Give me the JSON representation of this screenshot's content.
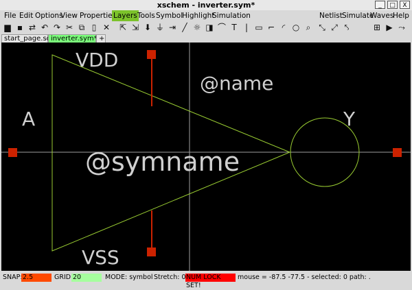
{
  "window": {
    "title": "xschem - inverter.sym*",
    "btn_min": "_",
    "btn_max": "□",
    "btn_close": "X"
  },
  "menu": {
    "left": [
      "File",
      "Edit",
      "Options",
      "View",
      "Properties",
      "Layers",
      "Tools",
      "Symbol",
      "Highlight",
      "Simulation"
    ],
    "right": [
      "Netlist",
      "Simulate",
      "Waves",
      "Help"
    ],
    "active": "Layers"
  },
  "toolbar": {
    "icons": [
      "open-folder-icon",
      "save-icon",
      "reload-icon",
      "undo-icon",
      "redo-icon",
      "cut-icon",
      "copy-icon",
      "delete-icon",
      "move-icon",
      "descend-icon",
      "ascend-icon",
      "duplicate-icon",
      "wire-icon",
      "pin-icon",
      "label-icon",
      "probe-icon",
      "line-icon",
      "rect-icon",
      "polygon-icon",
      "arc-icon",
      "circle-icon",
      "zoom-icon",
      "zoom-fit-icon",
      "zoom-in-icon",
      "zoom-out-icon",
      "netlist-icon",
      "simulate-icon",
      "waves-icon"
    ]
  },
  "tabs": [
    {
      "label": "start_page.sch",
      "active": false
    },
    {
      "label": "inverter.sym*",
      "active": true
    },
    {
      "label": "+",
      "active": false
    }
  ],
  "canvas": {
    "labels": {
      "vdd": "VDD",
      "name": "@name",
      "a": "A",
      "y": "Y",
      "symname": "@symname",
      "vss": "VSS"
    },
    "colors": {
      "background": "#000000",
      "symbol": "#9acd32",
      "pin": "#cc2200",
      "text": "#d0d0d0",
      "axis": "#a0a0a0"
    }
  },
  "status": {
    "snap_label": "SNAP:",
    "snap_value": "2.5",
    "grid_label": "GRID:",
    "grid_value": "20",
    "mode": "MODE:  symbol",
    "stretch": "Stretch: 0",
    "numlock": "NUM LOCK SET!",
    "mouse": "mouse = -87.5 -77.5 - selected: 0 path: .",
    "colors": {
      "snap_bg": "#ff4a00",
      "grid_bg": "#a6ff9e",
      "numlock_bg": "#ff0000"
    }
  }
}
